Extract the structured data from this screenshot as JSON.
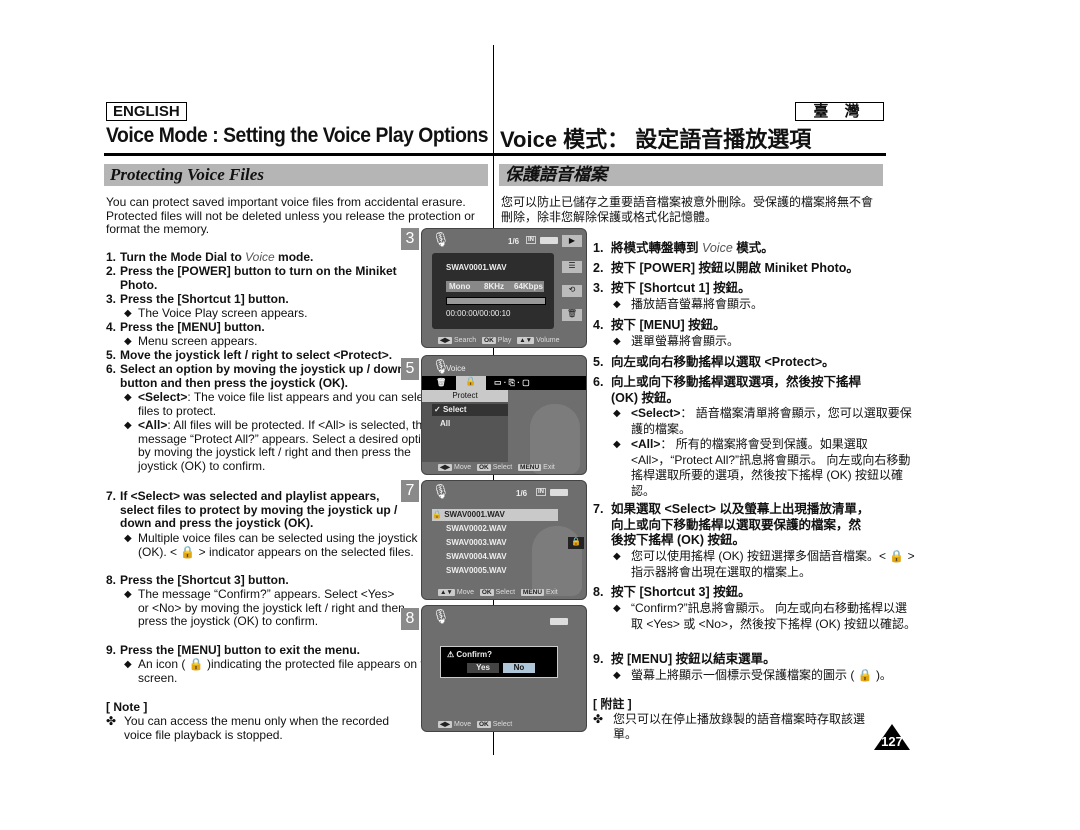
{
  "header": {
    "lang_en": "ENGLISH",
    "lang_zh": "臺 灣",
    "title_en": "Voice Mode : Setting the Voice Play Options",
    "title_zh": "Voice 模式： 設定語音播放選項"
  },
  "section": {
    "title_en": "Protecting Voice Files",
    "title_zh": "保護語音檔案"
  },
  "english": {
    "intro": "You can protect saved important voice files from accidental erasure. Protected files will not be deleted unless you release the protection or format the memory.",
    "steps": [
      {
        "num": "1.",
        "pre": "Turn the Mode Dial to ",
        "italic": "Voice",
        "post": " mode."
      },
      {
        "num": "2.",
        "text": "Press the [POWER] button to turn on the Miniket Photo."
      },
      {
        "num": "3.",
        "text": "Press the [Shortcut 1] button.",
        "bullets": [
          "The Voice Play screen appears."
        ]
      },
      {
        "num": "4.",
        "text": "Press the [MENU] button.",
        "bullets": [
          "Menu screen appears."
        ]
      },
      {
        "num": "5.",
        "text": "Move the joystick left / right to select <Protect>."
      },
      {
        "num": "6.",
        "text": "Select an option by moving the joystick up / down button and then press the joystick (OK).",
        "bullets": [
          {
            "bold": "<Select>",
            "text": ": The voice file list appears and you can select files to protect."
          },
          {
            "bold": "<All>",
            "text": ": All files will be protected. If <All> is selected, the message “Protect All?” appears. Select a desired option by moving the joystick left / right and then press the joystick (OK) to confirm."
          }
        ]
      },
      {
        "num": "7.",
        "text": "If <Select> was selected and playlist appears, select files to protect by moving the joystick up / down and press the joystick (OK).",
        "bullets": [
          "Multiple voice files can be selected using the joystick (OK). < 🔒 > indicator appears on the selected files."
        ]
      },
      {
        "num": "8.",
        "text": "Press the [Shortcut 3] button.",
        "bullets": [
          "The message “Confirm?” appears. Select <Yes> or <No> by moving the joystick left / right and then press the joystick (OK) to confirm."
        ]
      },
      {
        "num": "9.",
        "text": "Press the [MENU] button to exit the menu.",
        "bullets": [
          "An icon ( 🔒 )indicating the protected file appears on the screen."
        ]
      }
    ],
    "note_title": "[ Note ]",
    "note_text": "You can access the menu only when the recorded voice file playback is stopped."
  },
  "chinese": {
    "intro": "您可以防止已儲存之重要語音檔案被意外刪除。受保護的檔案將無不會刪除，除非您解除保護或格式化記憶體。",
    "steps": [
      {
        "num": "1.",
        "pre": "將模式轉盤轉到 ",
        "italic": "Voice",
        "post": " 模式。"
      },
      {
        "num": "2.",
        "text": "按下 [POWER] 按鈕以開啟 Miniket Photo。"
      },
      {
        "num": "3.",
        "text": "按下 [Shortcut 1] 按鈕。",
        "bullets": [
          "播放語音螢幕將會顯示。"
        ]
      },
      {
        "num": "4.",
        "text": "按下 [MENU] 按鈕。",
        "bullets": [
          "選單螢幕將會顯示。"
        ]
      },
      {
        "num": "5.",
        "text": "向左或向右移動搖桿以選取 <Protect>。"
      },
      {
        "num": "6.",
        "text": "向上或向下移動搖桿選取選項，然後按下搖桿 (OK) 按鈕。",
        "bullets": [
          {
            "bold": "<Select>",
            "text": "： 語音檔案清單將會顯示，您可以選取要保護的檔案。"
          },
          {
            "bold": "<All>",
            "text": "： 所有的檔案將會受到保護。如果選取 <All>，“Protect All?”訊息將會顯示。 向左或向右移動搖桿選取所要的選項，然後按下搖桿 (OK) 按鈕以確認。"
          }
        ]
      },
      {
        "num": "7.",
        "text": "如果選取 <Select> 以及螢幕上出現播放清單，向上或向下移動搖桿以選取要保護的檔案，然後按下搖桿 (OK) 按鈕。",
        "bullets": [
          "您可以使用搖桿 (OK) 按鈕選擇多個語音檔案。< 🔒 > 指示器將會出現在選取的檔案上。"
        ]
      },
      {
        "num": "8.",
        "text": "按下 [Shortcut 3] 按鈕。",
        "bullets": [
          "“Confirm?”訊息將會顯示。 向左或向右移動搖桿以選取 <Yes> 或 <No>，然後按下搖桿 (OK) 按鈕以確認。"
        ]
      },
      {
        "num": "9.",
        "text": "按 [MENU] 按鈕以結束選單。",
        "bullets": [
          "螢幕上將顯示一個標示受保護檔案的圖示 ( 🔒 )。"
        ]
      }
    ],
    "note_title": "[ 附註 ]",
    "note_text": "您只可以在停止播放錄製的語音檔案時存取該選單。"
  },
  "screens": {
    "s3": {
      "num": "3",
      "counter": "1/6",
      "memory": "IN",
      "filename": "SWAV0001.WAV",
      "mode": "Mono",
      "rate": "8KHz",
      "bitrate": "64Kbps",
      "time": "00:00:00/00:00:10",
      "foot": [
        {
          "key": "◀▶",
          "label": "Search"
        },
        {
          "key": "OK",
          "label": "Play"
        },
        {
          "key": "▲▼",
          "label": "Volume"
        }
      ]
    },
    "s5": {
      "num": "5",
      "title": "Voice",
      "menu_header": "Protect",
      "options": [
        "Select",
        "All"
      ],
      "selected": "Select",
      "foot": [
        {
          "key": "◀▶",
          "label": "Move"
        },
        {
          "key": "OK",
          "label": "Select"
        },
        {
          "key": "MENU",
          "label": "Exit"
        }
      ]
    },
    "s7": {
      "num": "7",
      "counter": "1/6",
      "memory": "IN",
      "files": [
        "SWAV0001.WAV",
        "SWAV0002.WAV",
        "SWAV0003.WAV",
        "SWAV0004.WAV",
        "SWAV0005.WAV"
      ],
      "foot": [
        {
          "key": "▲▼",
          "label": "Move"
        },
        {
          "key": "OK",
          "label": "Select"
        },
        {
          "key": "MENU",
          "label": "Exit"
        }
      ]
    },
    "s8": {
      "num": "8",
      "dialog": "Confirm?",
      "yes": "Yes",
      "no": "No",
      "foot": [
        {
          "key": "◀▶",
          "label": "Move"
        },
        {
          "key": "OK",
          "label": "Select"
        }
      ]
    }
  },
  "page_number": "127"
}
